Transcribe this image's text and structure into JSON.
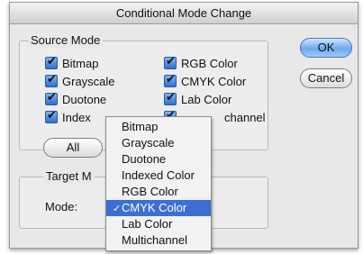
{
  "window": {
    "title": "Conditional Mode Change"
  },
  "source_mode": {
    "label": "Source Mode",
    "checkboxes": [
      {
        "label": "Bitmap",
        "checked": true
      },
      {
        "label": "Grayscale",
        "checked": true
      },
      {
        "label": "Duotone",
        "checked": true
      },
      {
        "label": "Index",
        "checked": true
      },
      {
        "label": "RGB Color",
        "checked": true
      },
      {
        "label": "CMYK Color",
        "checked": true
      },
      {
        "label": "Lab Color",
        "checked": true
      },
      {
        "label": "channel",
        "checked": true
      }
    ],
    "all_button": "All"
  },
  "target_mode": {
    "label": "Target M",
    "mode_label": "Mode:",
    "selected": "CMYK Color"
  },
  "buttons": {
    "ok": "OK",
    "cancel": "Cancel"
  },
  "mode_menu": {
    "items": [
      "Bitmap",
      "Grayscale",
      "Duotone",
      "Indexed Color",
      "RGB Color",
      "CMYK Color",
      "Lab Color",
      "Multichannel"
    ],
    "check_mark": "✓"
  }
}
